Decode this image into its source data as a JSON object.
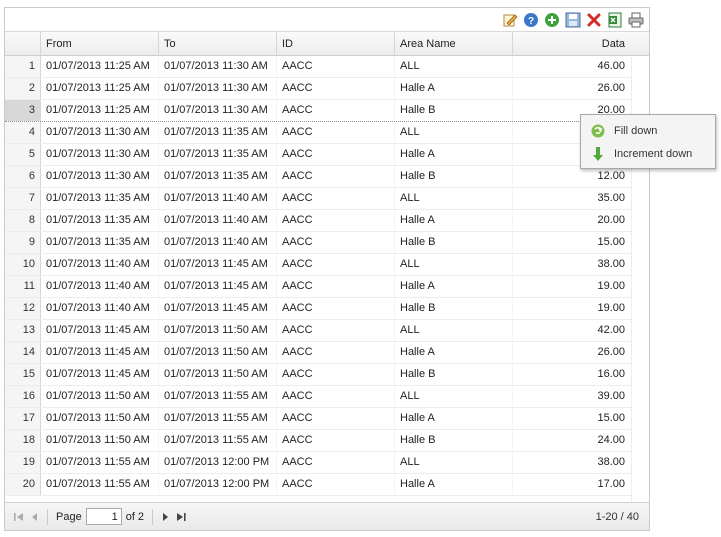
{
  "columns": {
    "from": "From",
    "to": "To",
    "id": "ID",
    "area": "Area Name",
    "data": "Data"
  },
  "rows": [
    {
      "n": "1",
      "from": "01/07/2013 11:25 AM",
      "to": "01/07/2013 11:30 AM",
      "id": "AACC",
      "area": "ALL",
      "data": "46.00"
    },
    {
      "n": "2",
      "from": "01/07/2013 11:25 AM",
      "to": "01/07/2013 11:30 AM",
      "id": "AACC",
      "area": "Halle A",
      "data": "26.00"
    },
    {
      "n": "3",
      "from": "01/07/2013 11:25 AM",
      "to": "01/07/2013 11:30 AM",
      "id": "AACC",
      "area": "Halle B",
      "data": "20.00"
    },
    {
      "n": "4",
      "from": "01/07/2013 11:30 AM",
      "to": "01/07/2013 11:35 AM",
      "id": "AACC",
      "area": "ALL",
      "data": ""
    },
    {
      "n": "5",
      "from": "01/07/2013 11:30 AM",
      "to": "01/07/2013 11:35 AM",
      "id": "AACC",
      "area": "Halle A",
      "data": ""
    },
    {
      "n": "6",
      "from": "01/07/2013 11:30 AM",
      "to": "01/07/2013 11:35 AM",
      "id": "AACC",
      "area": "Halle B",
      "data": "12.00"
    },
    {
      "n": "7",
      "from": "01/07/2013 11:35 AM",
      "to": "01/07/2013 11:40 AM",
      "id": "AACC",
      "area": "ALL",
      "data": "35.00"
    },
    {
      "n": "8",
      "from": "01/07/2013 11:35 AM",
      "to": "01/07/2013 11:40 AM",
      "id": "AACC",
      "area": "Halle A",
      "data": "20.00"
    },
    {
      "n": "9",
      "from": "01/07/2013 11:35 AM",
      "to": "01/07/2013 11:40 AM",
      "id": "AACC",
      "area": "Halle B",
      "data": "15.00"
    },
    {
      "n": "10",
      "from": "01/07/2013 11:40 AM",
      "to": "01/07/2013 11:45 AM",
      "id": "AACC",
      "area": "ALL",
      "data": "38.00"
    },
    {
      "n": "11",
      "from": "01/07/2013 11:40 AM",
      "to": "01/07/2013 11:45 AM",
      "id": "AACC",
      "area": "Halle A",
      "data": "19.00"
    },
    {
      "n": "12",
      "from": "01/07/2013 11:40 AM",
      "to": "01/07/2013 11:45 AM",
      "id": "AACC",
      "area": "Halle B",
      "data": "19.00"
    },
    {
      "n": "13",
      "from": "01/07/2013 11:45 AM",
      "to": "01/07/2013 11:50 AM",
      "id": "AACC",
      "area": "ALL",
      "data": "42.00"
    },
    {
      "n": "14",
      "from": "01/07/2013 11:45 AM",
      "to": "01/07/2013 11:50 AM",
      "id": "AACC",
      "area": "Halle A",
      "data": "26.00"
    },
    {
      "n": "15",
      "from": "01/07/2013 11:45 AM",
      "to": "01/07/2013 11:50 AM",
      "id": "AACC",
      "area": "Halle B",
      "data": "16.00"
    },
    {
      "n": "16",
      "from": "01/07/2013 11:50 AM",
      "to": "01/07/2013 11:55 AM",
      "id": "AACC",
      "area": "ALL",
      "data": "39.00"
    },
    {
      "n": "17",
      "from": "01/07/2013 11:50 AM",
      "to": "01/07/2013 11:55 AM",
      "id": "AACC",
      "area": "Halle A",
      "data": "15.00"
    },
    {
      "n": "18",
      "from": "01/07/2013 11:50 AM",
      "to": "01/07/2013 11:55 AM",
      "id": "AACC",
      "area": "Halle B",
      "data": "24.00"
    },
    {
      "n": "19",
      "from": "01/07/2013 11:55 AM",
      "to": "01/07/2013 12:00 PM",
      "id": "AACC",
      "area": "ALL",
      "data": "38.00"
    },
    {
      "n": "20",
      "from": "01/07/2013 11:55 AM",
      "to": "01/07/2013 12:00 PM",
      "id": "AACC",
      "area": "Halle A",
      "data": "17.00"
    }
  ],
  "selected_row": "3",
  "toolbar": {
    "icons": [
      "edit-icon",
      "help-icon",
      "add-icon",
      "save-icon",
      "delete-icon",
      "excel-export-icon",
      "print-icon"
    ]
  },
  "pager": {
    "page_label": "Page",
    "page_value": "1",
    "of_label": "of 2",
    "info": "1-20 / 40"
  },
  "context_menu": {
    "fill_down": "Fill down",
    "increment_down": "Increment down"
  },
  "colors": {
    "add_green": "#3da33d",
    "delete_red": "#d42a2a",
    "help_blue": "#3b78c8"
  }
}
